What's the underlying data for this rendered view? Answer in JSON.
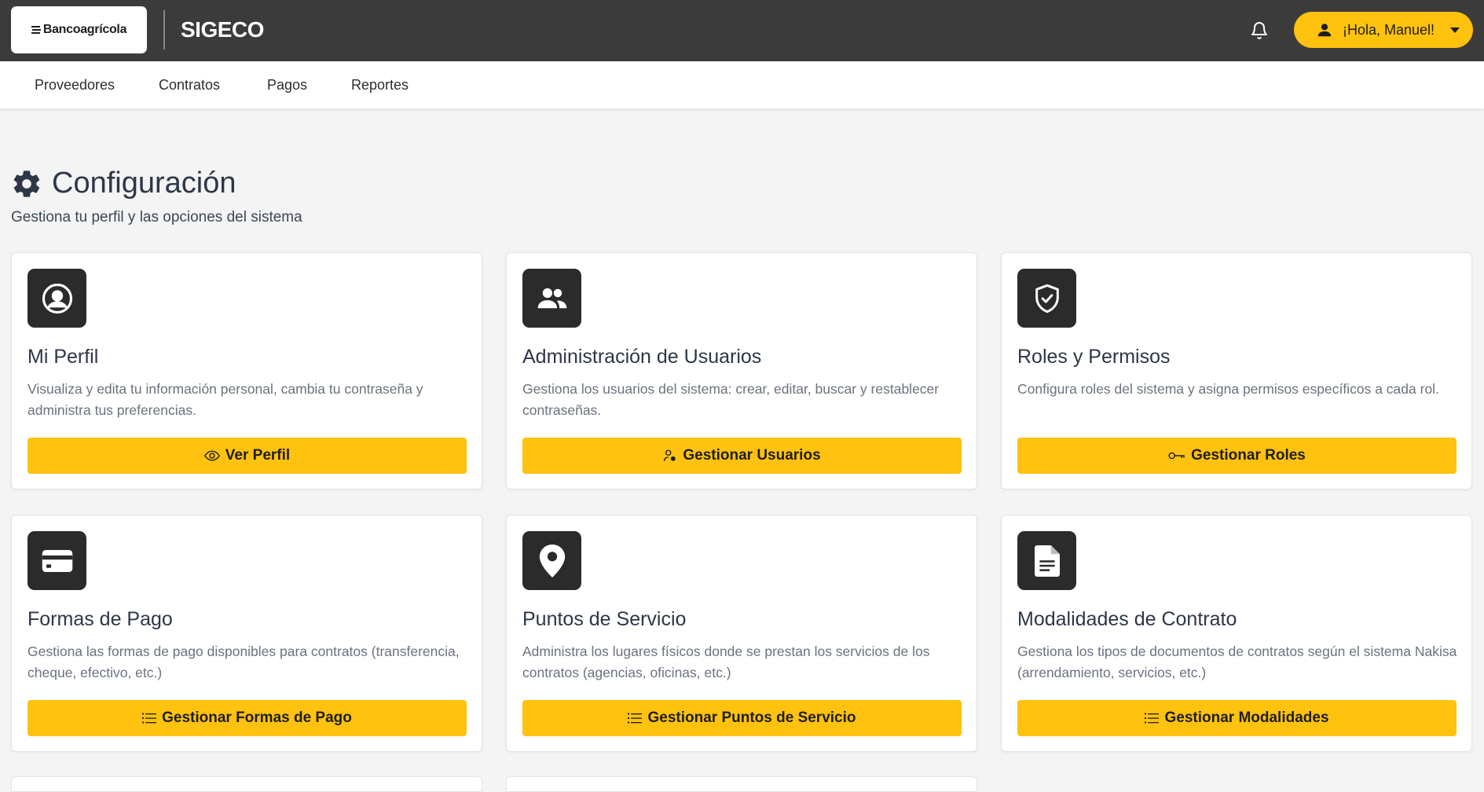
{
  "header": {
    "brand": "Bancoagrícola",
    "app_title": "SIGECO",
    "user_greeting": "¡Hola, Manuel!"
  },
  "nav": {
    "items": [
      {
        "label": "Proveedores"
      },
      {
        "label": "Contratos"
      },
      {
        "label": "Pagos"
      },
      {
        "label": "Reportes"
      }
    ]
  },
  "page": {
    "title": "Configuración",
    "subtitle": "Gestiona tu perfil y las opciones del sistema"
  },
  "cards": [
    {
      "icon": "user-circle-icon",
      "title": "Mi Perfil",
      "description": "Visualiza y edita tu información personal, cambia tu contraseña y administra tus preferencias.",
      "button_icon": "eye-icon",
      "button_label": "Ver Perfil"
    },
    {
      "icon": "users-icon",
      "title": "Administración de Usuarios",
      "description": "Gestiona los usuarios del sistema: crear, editar, buscar y restablecer contraseñas.",
      "button_icon": "user-gear-icon",
      "button_label": "Gestionar Usuarios"
    },
    {
      "icon": "shield-check-icon",
      "title": "Roles y Permisos",
      "description": "Configura roles del sistema y asigna permisos específicos a cada rol.",
      "button_icon": "key-icon",
      "button_label": "Gestionar Roles"
    },
    {
      "icon": "credit-card-icon",
      "title": "Formas de Pago",
      "description": "Gestiona las formas de pago disponibles para contratos (transferencia, cheque, efectivo, etc.)",
      "button_icon": "list-icon",
      "button_label": "Gestionar Formas de Pago"
    },
    {
      "icon": "map-pin-icon",
      "title": "Puntos de Servicio",
      "description": "Administra los lugares físicos donde se prestan los servicios de los contratos (agencias, oficinas, etc.)",
      "button_icon": "list-icon",
      "button_label": "Gestionar Puntos de Servicio"
    },
    {
      "icon": "document-icon",
      "title": "Modalidades de Contrato",
      "description": "Gestiona los tipos de documentos de contratos según el sistema Nakisa (arrendamiento, servicios, etc.)",
      "button_icon": "list-icon",
      "button_label": "Gestionar Modalidades"
    }
  ],
  "colors": {
    "topbar": "#3b3b3b",
    "accent": "#ffc20e",
    "icon_tile": "#2b2b2b",
    "background": "#f4f4f4"
  }
}
